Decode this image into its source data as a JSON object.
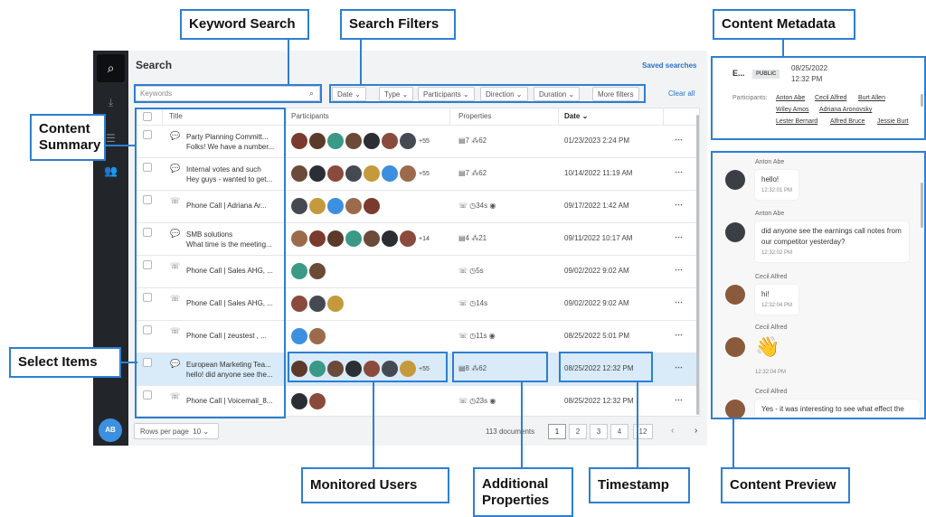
{
  "annotations": {
    "keyword_search": "Keyword Search",
    "search_filters": "Search Filters",
    "content_metadata": "Content Metadata",
    "content_summary": "Content Summary",
    "select_items": "Select Items",
    "monitored_users": "Monitored Users",
    "additional_properties": "Additional Properties",
    "timestamp": "Timestamp",
    "content_preview": "Content Preview"
  },
  "rail": {
    "user_initials": "AB"
  },
  "header": {
    "title": "Search",
    "saved_searches": "Saved searches"
  },
  "search": {
    "placeholder": "Keywords"
  },
  "filters": {
    "date": "Date",
    "type": "Type",
    "participants": "Participants",
    "direction": "Direction",
    "duration": "Duration",
    "more": "More filters",
    "clear": "Clear all"
  },
  "columns": {
    "title": "Title",
    "participants": "Participants",
    "properties": "Properties",
    "date": "Date"
  },
  "rows": [
    {
      "type": "chat",
      "line1": "Party Planning Committ...",
      "line2": "Folks! We have a number...",
      "more": "+55",
      "props": "▤7 ⁂62",
      "date": "01/23/2023 2:24 PM"
    },
    {
      "type": "chat",
      "line1": "Internal votes and such",
      "line2": "Hey guys - wanted to get...",
      "more": "+55",
      "props": "▤7 ⁂62",
      "date": "10/14/2022 11:19 AM"
    },
    {
      "type": "call",
      "line1": "Phone Call | Adriana Ar...",
      "props": "☏ ◷34s ◉",
      "date": "09/17/2022 1:42 AM"
    },
    {
      "type": "chat",
      "line1": "SMB solutions",
      "line2": "What time is the meeting...",
      "more": "+14",
      "props": "▤4 ⁂21",
      "date": "09/11/2022 10:17 AM"
    },
    {
      "type": "call",
      "line1": "Phone Call | Sales AHG, ...",
      "props": "☏ ◷5s",
      "date": "09/02/2022 9:02 AM"
    },
    {
      "type": "call",
      "line1": "Phone Call | Sales AHG, ...",
      "props": "☏ ◷14s",
      "date": "09/02/2022 9:02 AM"
    },
    {
      "type": "call",
      "line1": "Phone Call | zeustest , ...",
      "props": "☏ ◷11s ◉",
      "date": "08/25/2022 5:01 PM"
    },
    {
      "type": "chat",
      "line1": "European Marketing Tea...",
      "line2": "hello! did anyone see the...",
      "more": "+55",
      "props": "▤8 ⁂62",
      "date": "08/25/2022 12:32 PM"
    },
    {
      "type": "call",
      "line1": "Phone Call | Voicemail_8...",
      "props": "☏ ◷23s ◉",
      "date": "08/25/2022 12:32 PM"
    }
  ],
  "footer": {
    "rows_label": "Rows per page",
    "rows_value": "10",
    "documents": "113 documents",
    "pages": [
      "1",
      "2",
      "3",
      "4",
      "12"
    ]
  },
  "metadata": {
    "title": "E...",
    "badge": "PUBLIC",
    "date": "08/25/2022",
    "time": "12:32 PM",
    "participants_label": "Participants:",
    "participants": [
      "Anton Abe",
      "Cecil Alfred",
      "Burt Allen",
      "Wiley Amos",
      "Adriana Aronovsky",
      "Lester Bernard",
      "Alfred Bruce",
      "Jessie Burt"
    ]
  },
  "preview": {
    "messages": [
      {
        "name": "Anton Abe",
        "text": "hello!",
        "time": "12:32:01 PM"
      },
      {
        "name": "Anton Abe",
        "text": "did anyone see the earnings call notes from our competitor yesterday?",
        "time": "12:32:02 PM"
      },
      {
        "name": "Cecil Alfred",
        "text": "hi!",
        "time": "12:32:04 PM"
      },
      {
        "name": "Cecil Alfred",
        "text": "👋",
        "time": "12:32:04 PM"
      },
      {
        "name": "Cecil Alfred",
        "text": "Yes - it was interesting to see what effect the",
        "time": ""
      }
    ]
  }
}
